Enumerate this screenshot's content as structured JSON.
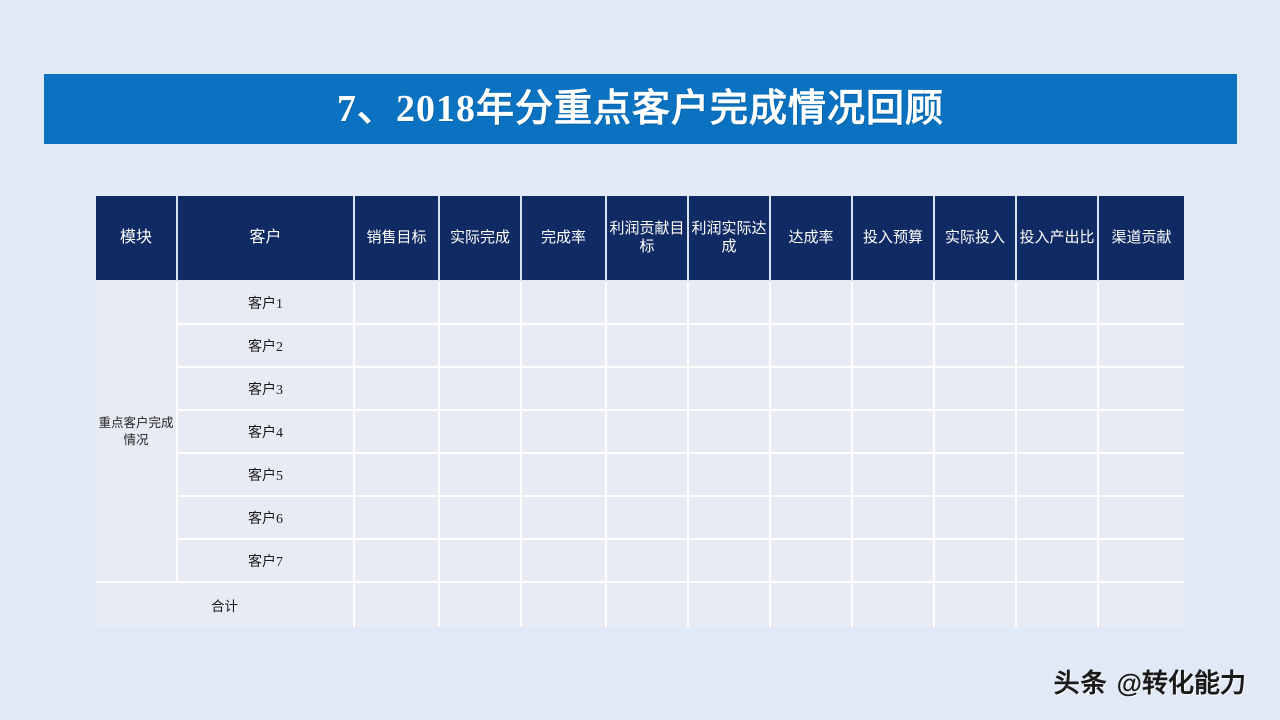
{
  "slide": {
    "background_color": "#e0e9f5",
    "title": "7、2018年分重点客户完成情况回顾",
    "banner_color": "#0a72c0"
  },
  "table": {
    "header_color": "#102a63",
    "cell_color": "#e8ebf3",
    "headers": [
      "模块",
      "客户",
      "销售目标",
      "实际完成",
      "完成率",
      "利润贡献目标",
      "利润实际达成",
      "达成率",
      "投入预算",
      "实际投入",
      "投入产出比",
      "渠道贡献"
    ],
    "module_label": "重点客户完成情况",
    "customers": [
      "客户1",
      "客户2",
      "客户3",
      "客户4",
      "客户5",
      "客户6",
      "客户7"
    ],
    "total_label": "合计",
    "empty_value": ""
  },
  "watermark": {
    "brand": "头条",
    "handle": "@转化能力"
  }
}
